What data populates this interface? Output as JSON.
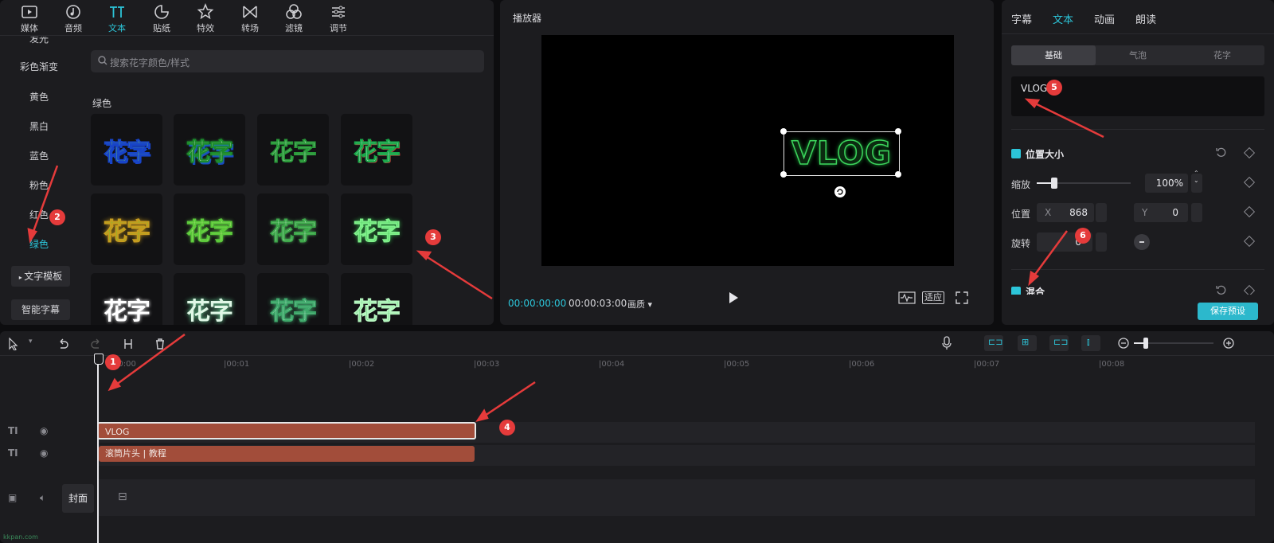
{
  "toolbar": {
    "items": [
      {
        "label": "媒体",
        "icon": "media-icon"
      },
      {
        "label": "音频",
        "icon": "audio-icon"
      },
      {
        "label": "文本",
        "icon": "text-icon"
      },
      {
        "label": "贴纸",
        "icon": "sticker-icon"
      },
      {
        "label": "特效",
        "icon": "effects-icon"
      },
      {
        "label": "转场",
        "icon": "transition-icon"
      },
      {
        "label": "滤镜",
        "icon": "filter-icon"
      },
      {
        "label": "调节",
        "icon": "adjust-icon"
      }
    ],
    "active": "文本"
  },
  "categories": [
    "发光",
    "彩色渐变",
    "黄色",
    "黑白",
    "蓝色",
    "粉色",
    "红色",
    "绿色"
  ],
  "active_category": "绿色",
  "side_buttons": {
    "text_template": "文字模板",
    "smart_subtitle": "智能字幕"
  },
  "search": {
    "placeholder": "搜索花字颜色/样式"
  },
  "section_title": "绿色",
  "tile_text": "花字",
  "player": {
    "title": "播放器",
    "preview_text": "VLOG",
    "current_time": "00:00:00:00",
    "total_time": "00:00:03:00",
    "quality": "画质",
    "fit": "适应"
  },
  "right": {
    "tabs": [
      "字幕",
      "文本",
      "动画",
      "朗读"
    ],
    "active_tab": "文本",
    "segments": [
      "基础",
      "气泡",
      "花字"
    ],
    "active_segment": "基础",
    "text_value": "VLOG",
    "position_size": "位置大小",
    "scale_label": "缩放",
    "scale_value": "100%",
    "position_label": "位置",
    "x_label": "X",
    "x_value": "868",
    "y_label": "Y",
    "y_value": "0",
    "rotate_label": "旋转",
    "rotate_value": "0°",
    "blend_label": "混合",
    "save_preset": "保存预设"
  },
  "timeline": {
    "ticks": [
      "00:00",
      "|00:01",
      "|00:02",
      "|00:03",
      "|00:04",
      "|00:05",
      "|00:06",
      "|00:07",
      "|00:08"
    ],
    "clip1": "VLOG",
    "clip2": "滚筒片头 | 教程",
    "cover": "封面"
  },
  "annotations": [
    "1",
    "2",
    "3",
    "4",
    "5",
    "6"
  ],
  "watermark": "kkpan.com",
  "colors": {
    "accent": "#2cc5d9",
    "clip": "#a24d3a",
    "panel": "#1c1c1f"
  }
}
